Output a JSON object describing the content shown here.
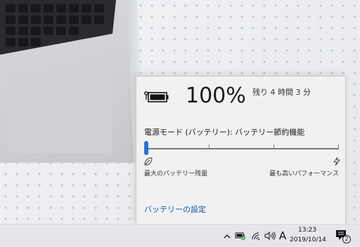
{
  "battery_flyout": {
    "percent": "100%",
    "remaining": "残り 4 時間 3 分",
    "power_mode_label": "電源モード (バッテリー): バッテリー節約機能",
    "slider_level": 0,
    "slider_min_label": "最大のバッテリー残量",
    "slider_max_label": "最も高いパフォーマンス",
    "settings_link": "バッテリーの設定",
    "icons": [
      "battery-icon",
      "leaf-icon",
      "lightning-icon"
    ]
  },
  "taskbar": {
    "ime_indicator": "A",
    "clock_time": "13:23",
    "clock_date": "2019/10/14",
    "notification_count": "2",
    "icons": [
      "chevron-up-icon",
      "battery-charging-icon",
      "wifi-icon",
      "volume-icon",
      "notification-icon"
    ]
  },
  "colors": {
    "accent": "#1c75d6",
    "link": "#0b56a6",
    "flyout_bg": "#f1f1f1",
    "taskbar_bg": "#e4e6ea"
  }
}
